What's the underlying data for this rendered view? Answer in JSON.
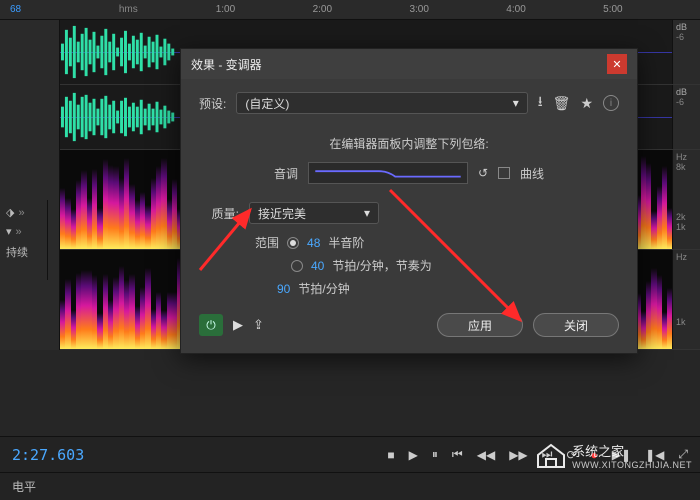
{
  "ruler": {
    "hms": "hms",
    "sel": "68",
    "t1": "1:00",
    "t2": "2:00",
    "t3": "3:00",
    "t4": "4:00",
    "t5": "5:00"
  },
  "scales": {
    "db": "dB",
    "db6": "-6",
    "hz": "Hz",
    "hz8k": "8k",
    "hz2k": "2k",
    "hz1k": "1k"
  },
  "side": {
    "marker_icon": "⬗",
    "dd_icon": "▾",
    "chev": "»",
    "keep": "持续"
  },
  "transport": {
    "tc": "2:27.603",
    "stop": "■",
    "play": "▶",
    "pause": "⏸",
    "skip_start": "⏮",
    "rew": "◀◀",
    "fwd": "▶▶",
    "skip_end": "⏭",
    "loop": "⟳",
    "rec": "●",
    "in": "▶❚",
    "out": "❚◀",
    "zoom": "⤢"
  },
  "bottom": {
    "level": "电平"
  },
  "dialog": {
    "title": "效果 - 变调器",
    "close": "✕",
    "preset_label": "预设:",
    "preset_value": "(自定义)",
    "dd": "▾",
    "dl_icon": "⭳",
    "trash_icon": "🗑",
    "star_icon": "★",
    "info_icon": "i",
    "env_label": "在编辑器面板内调整下列包络:",
    "pitch_label": "音调",
    "reset_icon": "↺",
    "curve_label": "曲线",
    "quality_label": "质量:",
    "quality_value": "接近完美",
    "range_label": "范围",
    "range_semitone_num": "48",
    "range_semitone_txt": "半音阶",
    "range_bpm_num": "40",
    "range_bpm_txt": "节拍/分钟，节奏为",
    "range_bpm_base_num": "90",
    "range_bpm_base_txt": "节拍/分钟",
    "power_icon": "⏻",
    "preview_icon": "▶",
    "share_icon": "⇪",
    "apply": "应用",
    "close_btn": "关闭"
  },
  "watermark": {
    "name": "系统之家",
    "url": "WWW.XITONGZHIJIA.NET"
  }
}
